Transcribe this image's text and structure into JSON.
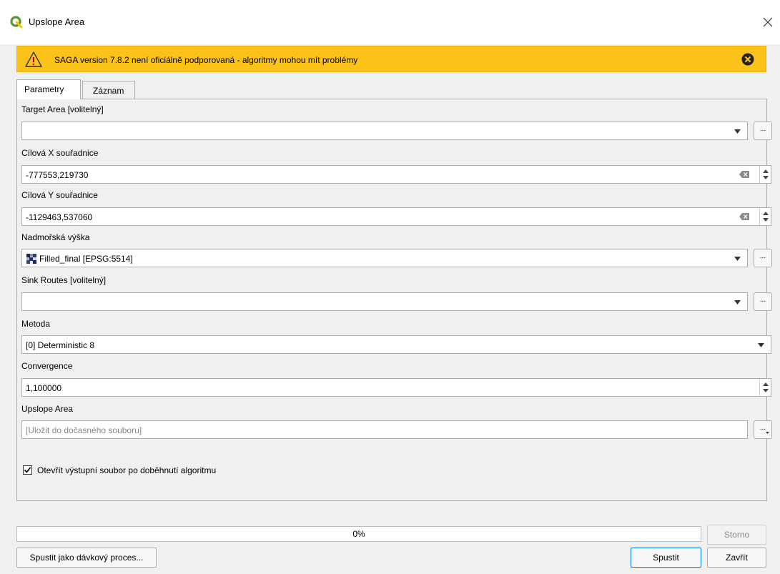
{
  "window": {
    "title": "Upslope Area"
  },
  "warning": {
    "text": "SAGA version 7.8.2 není oficiálně podporovaná - algoritmy mohou mít problémy"
  },
  "tabs": [
    {
      "label": "Parametry"
    },
    {
      "label": "Záznam"
    }
  ],
  "fields": {
    "target_area": {
      "label": "Target Area [volitelný]",
      "value": ""
    },
    "target_x": {
      "label": "Cílová X souřadnice",
      "value": "-777553,219730"
    },
    "target_y": {
      "label": "Cílová Y souřadnice",
      "value": "-1129463,537060"
    },
    "elevation": {
      "label": "Nadmořská výška",
      "value": "Filled_final [EPSG:5514]"
    },
    "sink_routes": {
      "label": "Sink Routes [volitelný]",
      "value": ""
    },
    "method": {
      "label": "Metoda",
      "value": "[0] Deterministic 8"
    },
    "convergence": {
      "label": "Convergence",
      "value": "1,100000"
    },
    "output": {
      "label": "Upslope Area",
      "placeholder": "[Uložit do dočasného souboru]"
    }
  },
  "checkbox": {
    "label": "Otevřít výstupní soubor po doběhnutí algoritmu",
    "checked": true
  },
  "progress": {
    "label": "0%",
    "value": 0
  },
  "buttons": {
    "cancel": "Storno",
    "batch": "Spustit jako dávkový proces...",
    "run": "Spustit",
    "close": "Zavřít",
    "browse": "..."
  },
  "colors": {
    "warning_bg": "#fbc31a",
    "accent": "#0078d7",
    "qgis_green": "#589632"
  }
}
